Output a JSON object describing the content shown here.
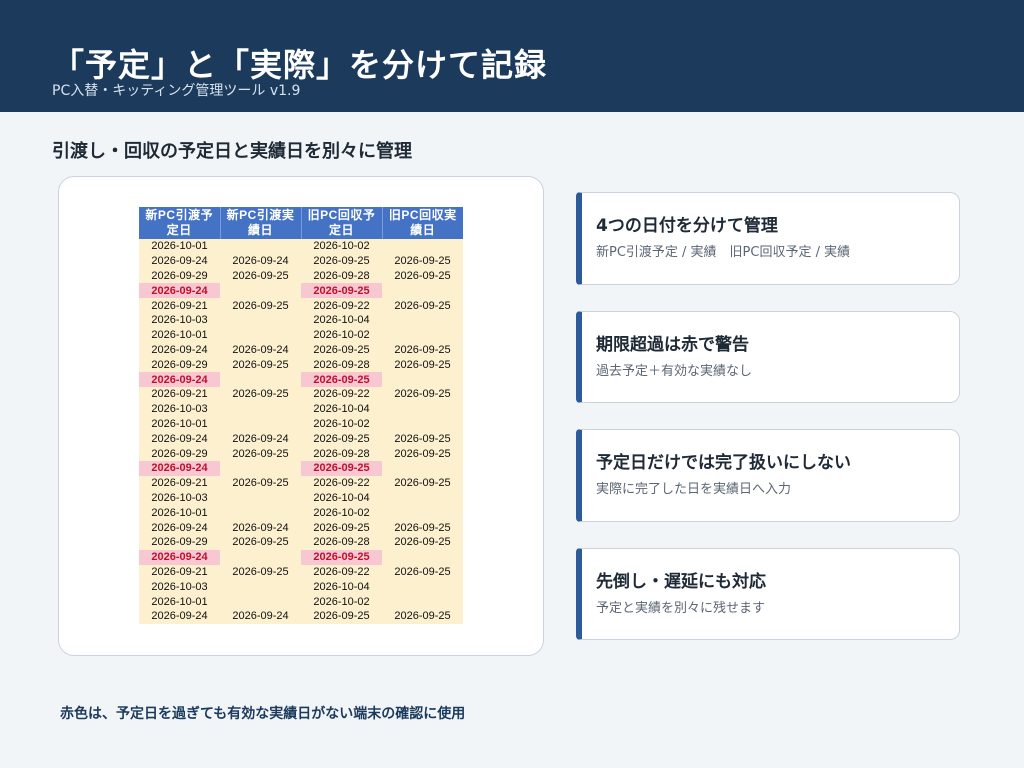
{
  "header": {
    "title": "「予定」と「実際」を分けて記録",
    "subtitle": "PC入替・キッティング管理ツール v1.9"
  },
  "section_heading": "引渡し・回収の予定日と実績日を別々に管理",
  "sheet": {
    "headers": [
      "新PC引渡予定日",
      "新PC引渡実績日",
      "旧PC回収予定日",
      "旧PC回収実績日"
    ],
    "rows": [
      {
        "cells": [
          "2026-10-01",
          "",
          "2026-10-02",
          ""
        ],
        "overdue": false
      },
      {
        "cells": [
          "2026-09-24",
          "2026-09-24",
          "2026-09-25",
          "2026-09-25"
        ],
        "overdue": false
      },
      {
        "cells": [
          "2026-09-29",
          "2026-09-25",
          "2026-09-28",
          "2026-09-25"
        ],
        "overdue": false
      },
      {
        "cells": [
          "2026-09-24",
          "",
          "2026-09-25",
          ""
        ],
        "overdue": true
      },
      {
        "cells": [
          "2026-09-21",
          "2026-09-25",
          "2026-09-22",
          "2026-09-25"
        ],
        "overdue": false
      },
      {
        "cells": [
          "2026-10-03",
          "",
          "2026-10-04",
          ""
        ],
        "overdue": false
      },
      {
        "cells": [
          "2026-10-01",
          "",
          "2026-10-02",
          ""
        ],
        "overdue": false
      },
      {
        "cells": [
          "2026-09-24",
          "2026-09-24",
          "2026-09-25",
          "2026-09-25"
        ],
        "overdue": false
      },
      {
        "cells": [
          "2026-09-29",
          "2026-09-25",
          "2026-09-28",
          "2026-09-25"
        ],
        "overdue": false
      },
      {
        "cells": [
          "2026-09-24",
          "",
          "2026-09-25",
          ""
        ],
        "overdue": true
      },
      {
        "cells": [
          "2026-09-21",
          "2026-09-25",
          "2026-09-22",
          "2026-09-25"
        ],
        "overdue": false
      },
      {
        "cells": [
          "2026-10-03",
          "",
          "2026-10-04",
          ""
        ],
        "overdue": false
      },
      {
        "cells": [
          "2026-10-01",
          "",
          "2026-10-02",
          ""
        ],
        "overdue": false
      },
      {
        "cells": [
          "2026-09-24",
          "2026-09-24",
          "2026-09-25",
          "2026-09-25"
        ],
        "overdue": false
      },
      {
        "cells": [
          "2026-09-29",
          "2026-09-25",
          "2026-09-28",
          "2026-09-25"
        ],
        "overdue": false
      },
      {
        "cells": [
          "2026-09-24",
          "",
          "2026-09-25",
          ""
        ],
        "overdue": true
      },
      {
        "cells": [
          "2026-09-21",
          "2026-09-25",
          "2026-09-22",
          "2026-09-25"
        ],
        "overdue": false
      },
      {
        "cells": [
          "2026-10-03",
          "",
          "2026-10-04",
          ""
        ],
        "overdue": false
      },
      {
        "cells": [
          "2026-10-01",
          "",
          "2026-10-02",
          ""
        ],
        "overdue": false
      },
      {
        "cells": [
          "2026-09-24",
          "2026-09-24",
          "2026-09-25",
          "2026-09-25"
        ],
        "overdue": false
      },
      {
        "cells": [
          "2026-09-29",
          "2026-09-25",
          "2026-09-28",
          "2026-09-25"
        ],
        "overdue": false
      },
      {
        "cells": [
          "2026-09-24",
          "",
          "2026-09-25",
          ""
        ],
        "overdue": true
      },
      {
        "cells": [
          "2026-09-21",
          "2026-09-25",
          "2026-09-22",
          "2026-09-25"
        ],
        "overdue": false
      },
      {
        "cells": [
          "2026-10-03",
          "",
          "2026-10-04",
          ""
        ],
        "overdue": false
      },
      {
        "cells": [
          "2026-10-01",
          "",
          "2026-10-02",
          ""
        ],
        "overdue": false
      },
      {
        "cells": [
          "2026-09-24",
          "2026-09-24",
          "2026-09-25",
          "2026-09-25"
        ],
        "overdue": false
      }
    ]
  },
  "cards": [
    {
      "title": "4つの日付を分けて管理",
      "desc": "新PC引渡予定 / 実績　旧PC回収予定 / 実績"
    },
    {
      "title": "期限超過は赤で警告",
      "desc": "過去予定＋有効な実績なし"
    },
    {
      "title": "予定日だけでは完了扱いにしない",
      "desc": "実際に完了した日を実績日へ入力"
    },
    {
      "title": "先倒し・遅延にも対応",
      "desc": "予定と実績を別々に残せます"
    }
  ],
  "footer_note": "赤色は、予定日を過ぎても有効な実績日がない端末の確認に使用",
  "colors": {
    "header_bg": "#1b3a5c",
    "accent": "#2c5a9a",
    "table_header": "#4472c4",
    "cell_bg": "#fdf0cf",
    "warn_bg": "#f8c8d2",
    "warn_text": "#c0102f"
  }
}
